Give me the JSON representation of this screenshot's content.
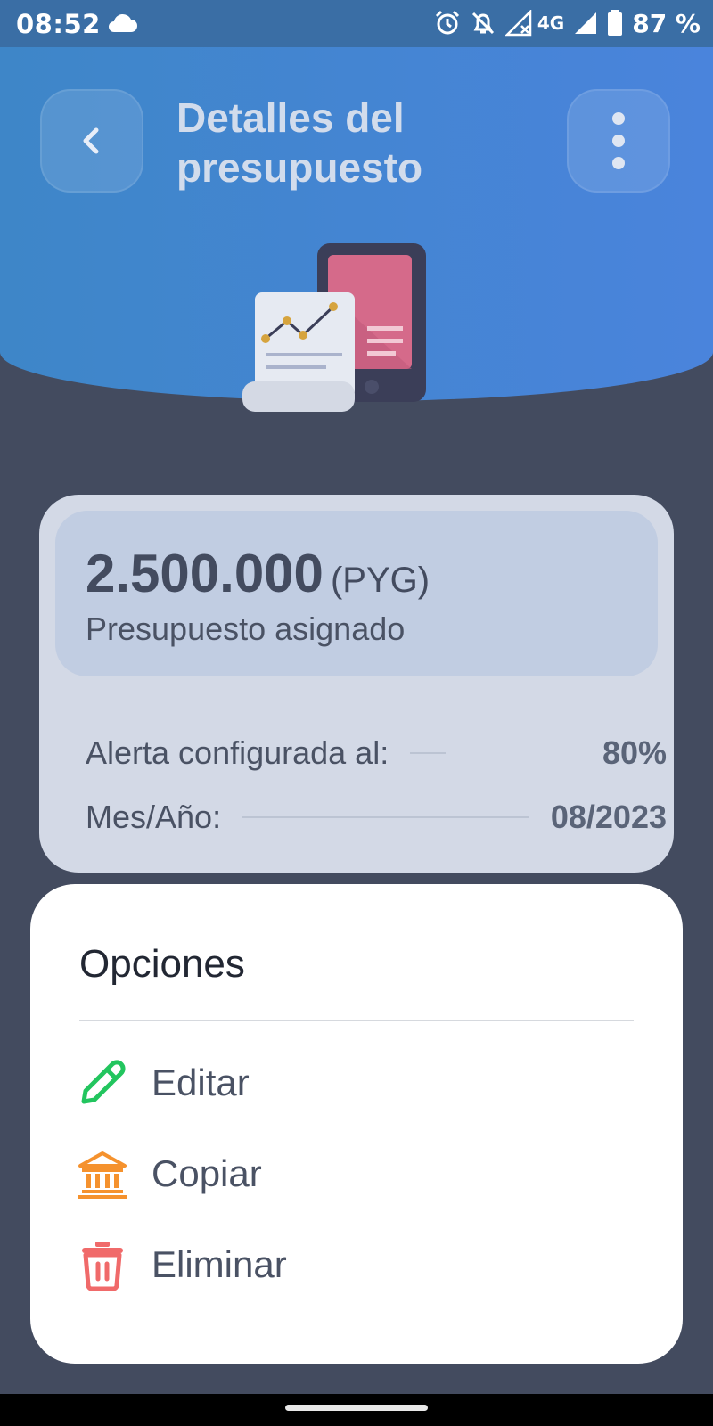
{
  "status_bar": {
    "time": "08:52",
    "network": "4G",
    "battery": "87 %"
  },
  "header": {
    "title": "Detalles del presupuesto",
    "back_icon": "chevron-left-icon",
    "more_icon": "more-vertical-icon"
  },
  "budget": {
    "amount": "2.500.000",
    "currency": "(PYG)",
    "amount_label": "Presupuesto asignado",
    "alert_label": "Alerta configurada al:",
    "alert_value": "80%",
    "period_label": "Mes/Año:",
    "period_value": "08/2023"
  },
  "options": {
    "title": "Opciones",
    "items": [
      {
        "label": "Editar",
        "icon": "pencil-icon",
        "color": "#22c55e"
      },
      {
        "label": "Copiar",
        "icon": "bank-icon",
        "color": "#f5922e"
      },
      {
        "label": "Eliminar",
        "icon": "trash-icon",
        "color": "#f06a6a"
      }
    ]
  },
  "colors": {
    "hero": "#4a84dc",
    "background": "#434b5f",
    "card": "#d3d9e6",
    "card_inner": "#c1cde2"
  }
}
